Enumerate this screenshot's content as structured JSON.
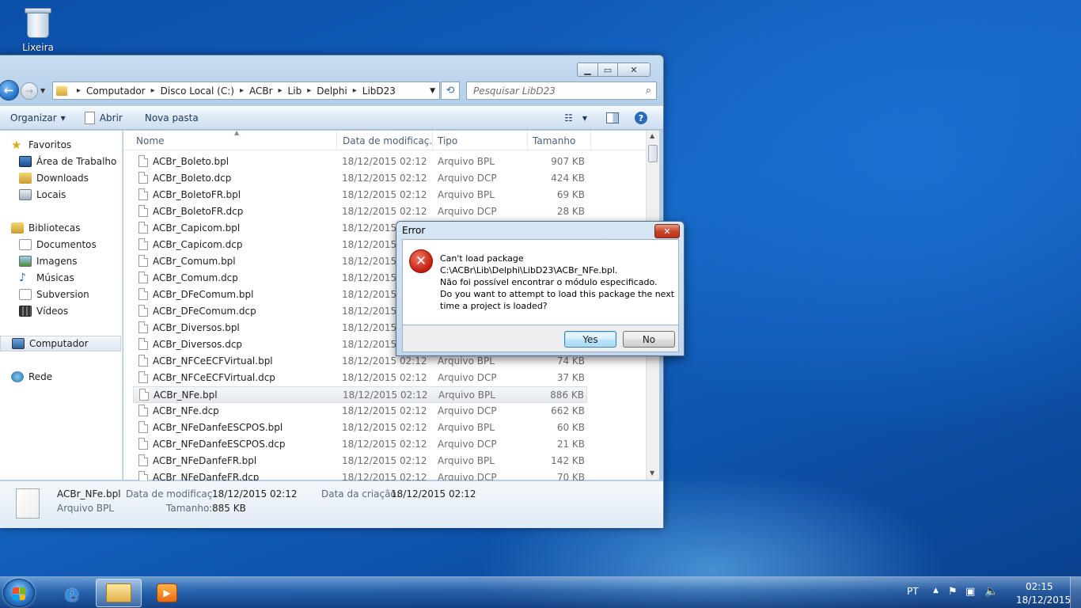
{
  "desktop": {
    "recycle_label": "Lixeira"
  },
  "explorer": {
    "address": [
      "Computador",
      "Disco Local (C:)",
      "ACBr",
      "Lib",
      "Delphi",
      "LibD23"
    ],
    "search_placeholder": "Pesquisar LibD23",
    "toolbar": {
      "organize": "Organizar",
      "open": "Abrir",
      "new_folder": "Nova pasta"
    },
    "nav": {
      "favorites": "Favoritos",
      "favorites_items": [
        "Área de Trabalho",
        "Downloads",
        "Locais"
      ],
      "libraries": "Bibliotecas",
      "libraries_items": [
        "Documentos",
        "Imagens",
        "Músicas",
        "Subversion",
        "Vídeos"
      ],
      "computer": "Computador",
      "network": "Rede"
    },
    "columns": {
      "name": "Nome",
      "date": "Data de modificaç...",
      "type": "Tipo",
      "size": "Tamanho"
    },
    "files": [
      {
        "name": "ACBr_Boleto.bpl",
        "date": "18/12/2015 02:12",
        "type": "Arquivo BPL",
        "size": "907 KB"
      },
      {
        "name": "ACBr_Boleto.dcp",
        "date": "18/12/2015 02:12",
        "type": "Arquivo DCP",
        "size": "424 KB"
      },
      {
        "name": "ACBr_BoletoFR.bpl",
        "date": "18/12/2015 02:12",
        "type": "Arquivo BPL",
        "size": "69 KB"
      },
      {
        "name": "ACBr_BoletoFR.dcp",
        "date": "18/12/2015 02:12",
        "type": "Arquivo DCP",
        "size": "28 KB"
      },
      {
        "name": "ACBr_Capicom.bpl",
        "date": "18/12/2015 0",
        "type": "",
        "size": ""
      },
      {
        "name": "ACBr_Capicom.dcp",
        "date": "18/12/2015 0",
        "type": "",
        "size": ""
      },
      {
        "name": "ACBr_Comum.bpl",
        "date": "18/12/2015 0",
        "type": "",
        "size": ""
      },
      {
        "name": "ACBr_Comum.dcp",
        "date": "18/12/2015 0",
        "type": "",
        "size": ""
      },
      {
        "name": "ACBr_DFeComum.bpl",
        "date": "18/12/2015 0",
        "type": "",
        "size": ""
      },
      {
        "name": "ACBr_DFeComum.dcp",
        "date": "18/12/2015 0",
        "type": "",
        "size": ""
      },
      {
        "name": "ACBr_Diversos.bpl",
        "date": "18/12/2015 0",
        "type": "",
        "size": ""
      },
      {
        "name": "ACBr_Diversos.dcp",
        "date": "18/12/2015 0",
        "type": "",
        "size": ""
      },
      {
        "name": "ACBr_NFCeECFVirtual.bpl",
        "date": "18/12/2015 02:12",
        "type": "Arquivo BPL",
        "size": "74 KB"
      },
      {
        "name": "ACBr_NFCeECFVirtual.dcp",
        "date": "18/12/2015 02:12",
        "type": "Arquivo DCP",
        "size": "37 KB"
      },
      {
        "name": "ACBr_NFe.bpl",
        "date": "18/12/2015 02:12",
        "type": "Arquivo BPL",
        "size": "886 KB"
      },
      {
        "name": "ACBr_NFe.dcp",
        "date": "18/12/2015 02:12",
        "type": "Arquivo DCP",
        "size": "662 KB"
      },
      {
        "name": "ACBr_NFeDanfeESCPOS.bpl",
        "date": "18/12/2015 02:12",
        "type": "Arquivo BPL",
        "size": "60 KB"
      },
      {
        "name": "ACBr_NFeDanfeESCPOS.dcp",
        "date": "18/12/2015 02:12",
        "type": "Arquivo DCP",
        "size": "21 KB"
      },
      {
        "name": "ACBr_NFeDanfeFR.bpl",
        "date": "18/12/2015 02:12",
        "type": "Arquivo BPL",
        "size": "142 KB"
      },
      {
        "name": "ACBr_NFeDanfeFR.dcp",
        "date": "18/12/2015 02:12",
        "type": "Arquivo DCP",
        "size": "70 KB"
      }
    ],
    "selected_index": 14,
    "details": {
      "name": "ACBr_NFe.bpl",
      "type": "Arquivo BPL",
      "modified_label": "Data de modificaç...",
      "modified": "18/12/2015 02:12",
      "size_label": "Tamanho:",
      "size": "885 KB",
      "created_label": "Data da criação:",
      "created": "18/12/2015 02:12"
    }
  },
  "dialog": {
    "title": "Error",
    "lines": [
      "Can't load package",
      "C:\\ACBr\\Lib\\Delphi\\LibD23\\ACBr_NFe.bpl.",
      "Não foi possível encontrar o módulo especificado.",
      "Do you want to attempt to load this package the next",
      "time a project is loaded?"
    ],
    "yes": "Yes",
    "no": "No"
  },
  "taskbar": {
    "language": "PT",
    "time": "02:15",
    "date": "18/12/2015"
  },
  "icons": [
    "recycle-bin-icon",
    "folder-icon",
    "search-icon",
    "refresh-icon",
    "document-icon",
    "view-icon",
    "preview-pane-icon",
    "help-icon",
    "star-icon",
    "desktop-icon",
    "downloads-icon",
    "locations-icon",
    "library-icon",
    "documents-icon",
    "images-icon",
    "music-icon",
    "subversion-icon",
    "video-icon",
    "computer-icon",
    "network-icon",
    "error-icon",
    "windows-start-icon",
    "internet-explorer-icon",
    "explorer-icon",
    "media-player-icon",
    "flag-icon",
    "network-tray-icon",
    "volume-icon"
  ],
  "colors": {
    "accent": "#1566c4",
    "error": "#c31b0b",
    "selection": "#e6eaee"
  }
}
